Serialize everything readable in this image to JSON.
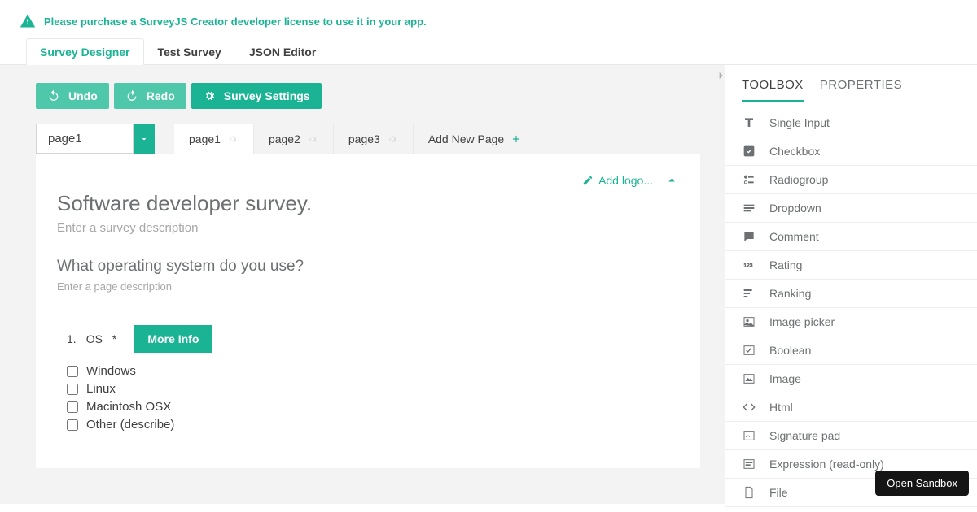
{
  "banner": {
    "text": "Please purchase a SurveyJS Creator developer license to use it in your app."
  },
  "tabs": {
    "designer": "Survey Designer",
    "test": "Test Survey",
    "json": "JSON Editor"
  },
  "toolbar": {
    "undo": "Undo",
    "redo": "Redo",
    "settings": "Survey Settings"
  },
  "pageSelect": {
    "value": "page1"
  },
  "pageTabs": {
    "items": [
      "page1",
      "page2",
      "page3"
    ],
    "add": "Add New Page"
  },
  "canvas": {
    "addLogo": "Add logo...",
    "surveyTitle": "Software developer survey.",
    "surveyDescPlaceholder": "Enter a survey description",
    "pageTitle": "What operating system do you use?",
    "pageDescPlaceholder": "Enter a page description"
  },
  "question": {
    "number": "1.",
    "label": "OS",
    "required": "*",
    "moreInfo": "More Info",
    "options": [
      "Windows",
      "Linux",
      "Macintosh OSX",
      "Other (describe)"
    ]
  },
  "side": {
    "tabs": {
      "toolbox": "TOOLBOX",
      "properties": "PROPERTIES"
    },
    "tools": [
      {
        "id": "single-input",
        "label": "Single Input"
      },
      {
        "id": "checkbox",
        "label": "Checkbox"
      },
      {
        "id": "radiogroup",
        "label": "Radiogroup"
      },
      {
        "id": "dropdown",
        "label": "Dropdown"
      },
      {
        "id": "comment",
        "label": "Comment"
      },
      {
        "id": "rating",
        "label": "Rating"
      },
      {
        "id": "ranking",
        "label": "Ranking"
      },
      {
        "id": "imagepicker",
        "label": "Image picker"
      },
      {
        "id": "boolean",
        "label": "Boolean"
      },
      {
        "id": "image",
        "label": "Image"
      },
      {
        "id": "html",
        "label": "Html"
      },
      {
        "id": "signature",
        "label": "Signature pad"
      },
      {
        "id": "expression",
        "label": "Expression (read-only)"
      },
      {
        "id": "file",
        "label": "File"
      }
    ]
  },
  "sandbox": {
    "label": "Open Sandbox"
  }
}
